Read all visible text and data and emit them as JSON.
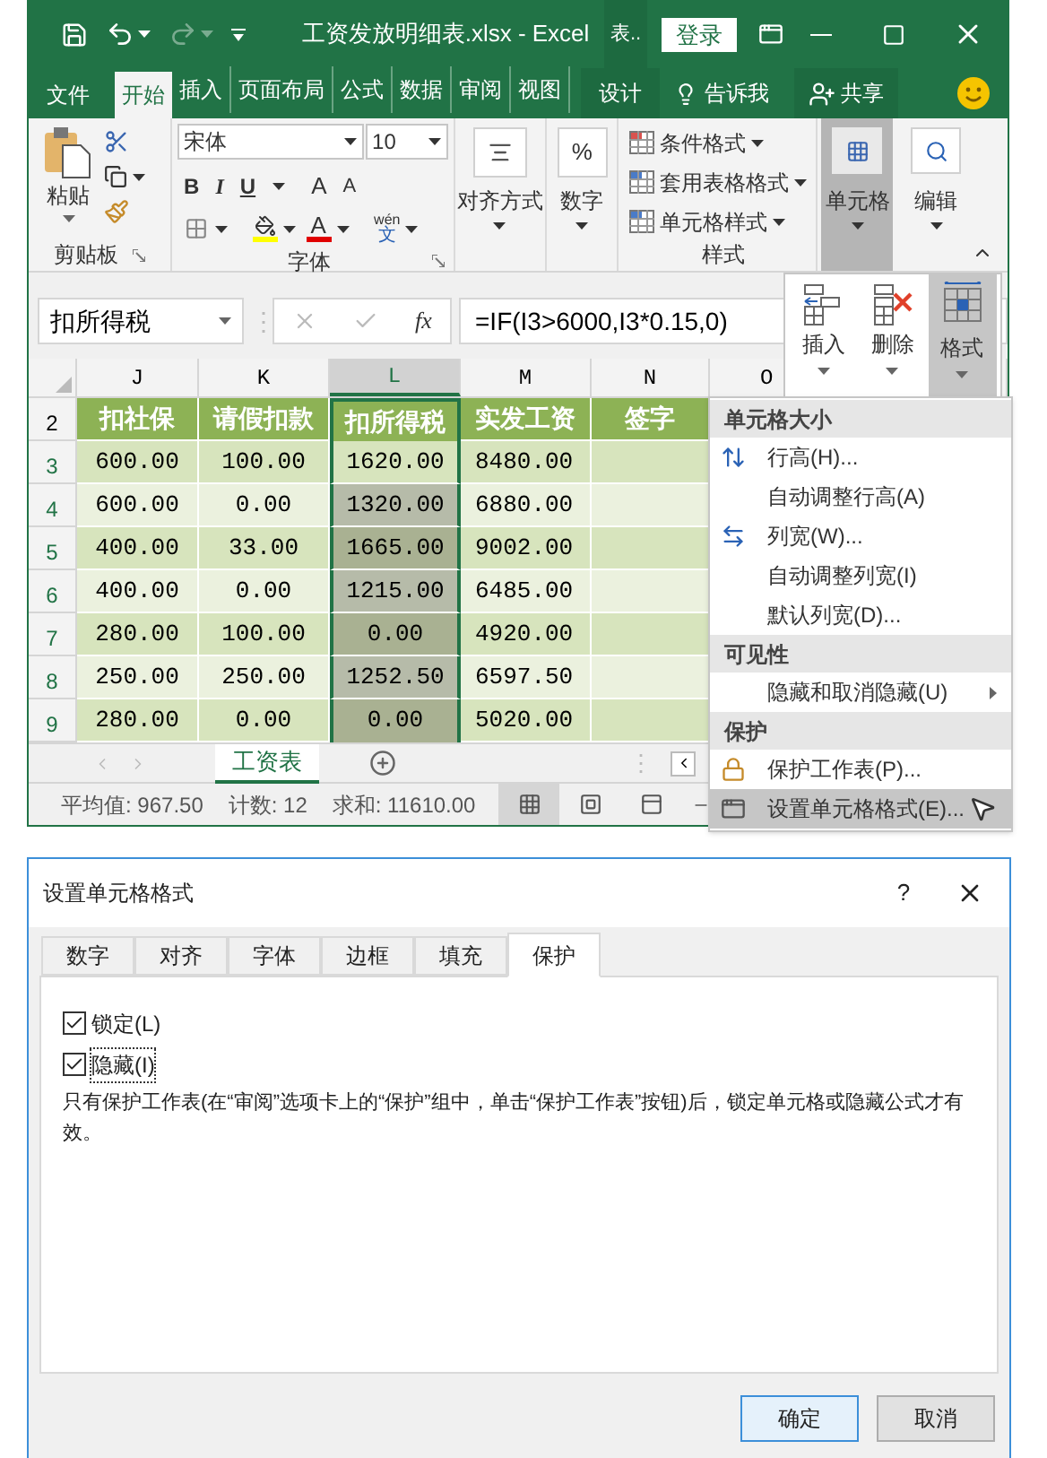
{
  "title_bar": {
    "title": "工资发放明细表.xlsx - Excel",
    "context_label": "表..",
    "login_button": "登录"
  },
  "ribbon_tabs": [
    {
      "label": "文件",
      "selected": false,
      "kind": "file"
    },
    {
      "label": "开始",
      "selected": true,
      "kind": "tab"
    },
    {
      "label": "插入",
      "selected": false,
      "kind": "tab"
    },
    {
      "label": "页面布局",
      "selected": false,
      "kind": "tab"
    },
    {
      "label": "公式",
      "selected": false,
      "kind": "tab"
    },
    {
      "label": "数据",
      "selected": false,
      "kind": "tab"
    },
    {
      "label": "审阅",
      "selected": false,
      "kind": "tab"
    },
    {
      "label": "视图",
      "selected": false,
      "kind": "tab"
    },
    {
      "label": "设计",
      "selected": false,
      "kind": "context"
    }
  ],
  "tell_me": "告诉我",
  "share_button": "共享",
  "ribbon": {
    "clipboard": {
      "paste": "粘贴",
      "label": "剪贴板"
    },
    "font": {
      "name": "宋体",
      "size": "10",
      "bold": "B",
      "italic": "I",
      "underline": "U",
      "grow": "A",
      "shrink": "A",
      "font_color": "A",
      "phonetic_top": "wén",
      "phonetic_bottom": "文",
      "label": "字体"
    },
    "alignment": "对齐方式",
    "number": {
      "symbol": "%",
      "label": "数字"
    },
    "styles": {
      "items": [
        "条件格式",
        "套用表格格式",
        "单元格样式"
      ],
      "label": "样式"
    },
    "cells": {
      "label": "单元格",
      "pressed": true
    },
    "editing": "编辑"
  },
  "formula_bar": {
    "name_box": "扣所得税",
    "splitter": "⋮",
    "fx": "fx",
    "formula": "=IF(I3>6000,I3*0.15,0)"
  },
  "sheet": {
    "columns": [
      {
        "letter": "J",
        "selected": false
      },
      {
        "letter": "K",
        "selected": false
      },
      {
        "letter": "L",
        "selected": true
      },
      {
        "letter": "M",
        "selected": false
      },
      {
        "letter": "N",
        "selected": false
      },
      {
        "letter": "O",
        "selected": false
      }
    ],
    "header_row": {
      "number": "2",
      "cells": [
        "扣社保",
        "请假扣款",
        "扣所得税",
        "实发工资",
        "签字"
      ]
    },
    "rows": [
      {
        "number": "3",
        "active": true,
        "cells": [
          "600.00",
          "100.00",
          "1620.00",
          "8480.00"
        ]
      },
      {
        "number": "4",
        "active": false,
        "cells": [
          "600.00",
          "0.00",
          "1320.00",
          "6880.00"
        ]
      },
      {
        "number": "5",
        "active": false,
        "cells": [
          "400.00",
          "33.00",
          "1665.00",
          "9002.00"
        ]
      },
      {
        "number": "6",
        "active": false,
        "cells": [
          "400.00",
          "0.00",
          "1215.00",
          "6485.00"
        ]
      },
      {
        "number": "7",
        "active": false,
        "cells": [
          "280.00",
          "100.00",
          "0.00",
          "4920.00"
        ]
      },
      {
        "number": "8",
        "active": false,
        "cells": [
          "250.00",
          "250.00",
          "1252.50",
          "6597.50"
        ]
      },
      {
        "number": "9",
        "active": false,
        "cells": [
          "280.00",
          "0.00",
          "0.00",
          "5020.00"
        ]
      }
    ]
  },
  "sheet_tabs": [
    {
      "label": "工资表",
      "selected": true
    }
  ],
  "tab_splitter": "⋮",
  "status_bar": {
    "stats": [
      "平均值: 967.50",
      "计数: 12",
      "求和: 11610.00"
    ],
    "view_buttons": [
      {
        "kind": "normal",
        "selected": true
      },
      {
        "kind": "page_layout",
        "selected": false
      },
      {
        "kind": "page_break",
        "selected": false
      }
    ]
  },
  "cells_dropdown": [
    {
      "label": "插入",
      "kind": "insert",
      "selected": false
    },
    {
      "label": "删除",
      "kind": "delete",
      "selected": false
    },
    {
      "label": "格式",
      "kind": "format",
      "selected": true
    }
  ],
  "format_menu": [
    {
      "kind": "header",
      "label": "单元格大小"
    },
    {
      "kind": "rowheight",
      "label": "行高(H)...",
      "selected": false
    },
    {
      "kind": "item",
      "label": "自动调整行高(A)",
      "selected": false
    },
    {
      "kind": "colwidth",
      "label": "列宽(W)...",
      "selected": false
    },
    {
      "kind": "item",
      "label": "自动调整列宽(I)",
      "selected": false
    },
    {
      "kind": "item",
      "label": "默认列宽(D)...",
      "selected": false
    },
    {
      "kind": "header",
      "label": "可见性"
    },
    {
      "kind": "item",
      "label": "隐藏和取消隐藏(U)",
      "submenu": true,
      "selected": false
    },
    {
      "kind": "header",
      "label": "保护"
    },
    {
      "kind": "protect",
      "label": "保护工作表(P)...",
      "selected": false
    },
    {
      "kind": "format",
      "label": "设置单元格格式(E)...",
      "selected": true
    }
  ],
  "dialog": {
    "title": "设置单元格格式",
    "help": "?",
    "tabs": [
      {
        "label": "数字",
        "selected": false
      },
      {
        "label": "对齐",
        "selected": false
      },
      {
        "label": "字体",
        "selected": false
      },
      {
        "label": "边框",
        "selected": false
      },
      {
        "label": "填充",
        "selected": false
      },
      {
        "label": "保护",
        "selected": true
      }
    ],
    "checkboxes": [
      {
        "label": "锁定(L)",
        "checked": true,
        "focused": false
      },
      {
        "label": "隐藏(I)",
        "checked": true,
        "focused": true
      }
    ],
    "note": "只有保护工作表(在“审阅”选项卡上的“保护”组中，单击“保护工作表”按钮)后，锁定单元格或隐藏公式才有效。",
    "buttons": [
      {
        "label": "确定",
        "default": true
      },
      {
        "label": "取消",
        "default": false
      }
    ]
  }
}
